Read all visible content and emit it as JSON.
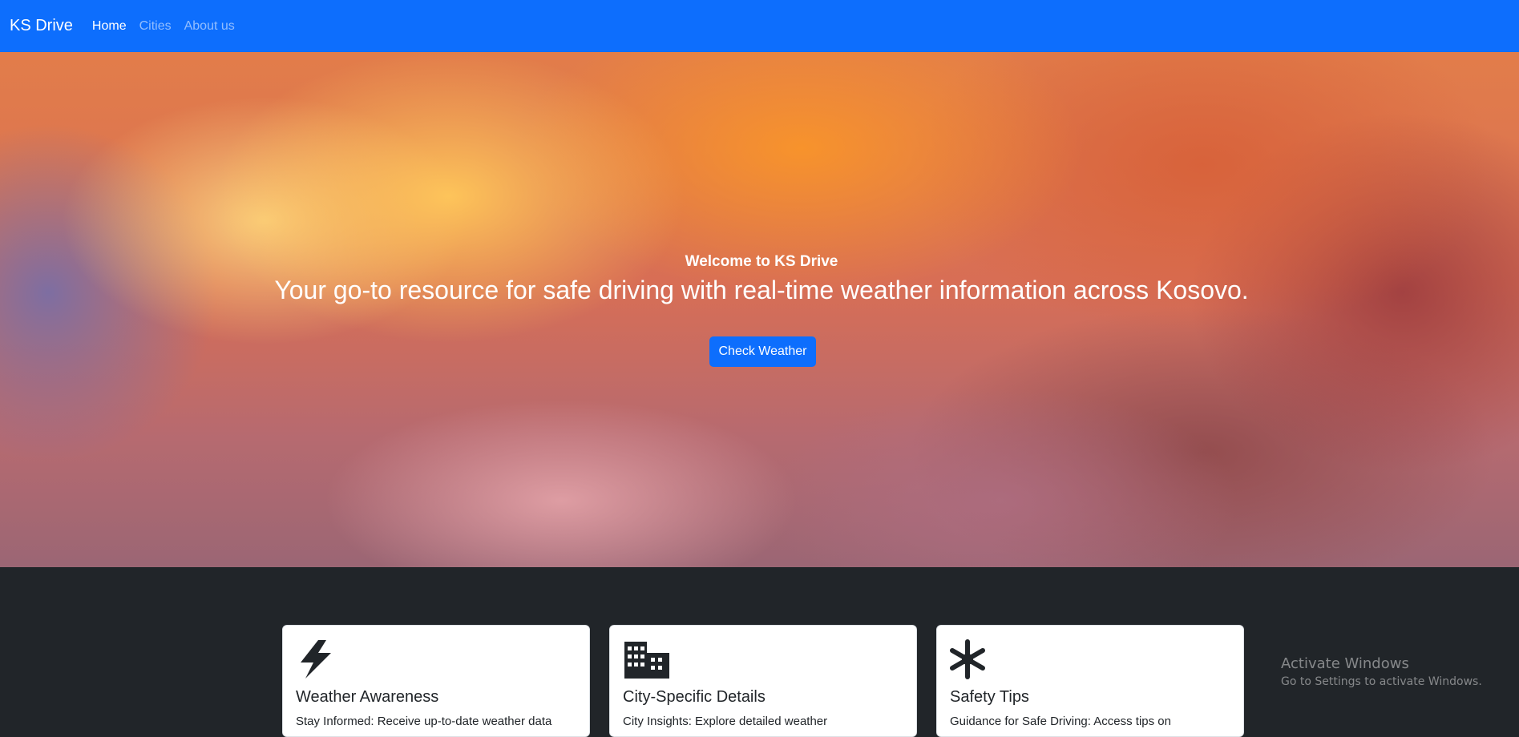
{
  "navbar": {
    "brand": "KS Drive",
    "links": [
      {
        "label": "Home"
      },
      {
        "label": "Cities"
      },
      {
        "label": "About us"
      }
    ]
  },
  "hero": {
    "welcome": "Welcome to KS Drive",
    "tagline": "Your go-to resource for safe driving with real-time weather information across Kosovo.",
    "button_label": "Check Weather"
  },
  "features": {
    "cards": [
      {
        "icon": "lightning-icon",
        "title": "Weather Awareness",
        "text": "Stay Informed: Receive up-to-date weather data"
      },
      {
        "icon": "buildings-icon",
        "title": "City-Specific Details",
        "text": "City Insights: Explore detailed weather"
      },
      {
        "icon": "snowflake-icon",
        "title": "Safety Tips",
        "text": "Guidance for Safe Driving: Access tips on"
      }
    ]
  },
  "watermark": {
    "title": "Activate Windows",
    "subtitle": "Go to Settings to activate Windows."
  },
  "colors": {
    "primary": "#0d6efd",
    "dark": "#212529"
  }
}
